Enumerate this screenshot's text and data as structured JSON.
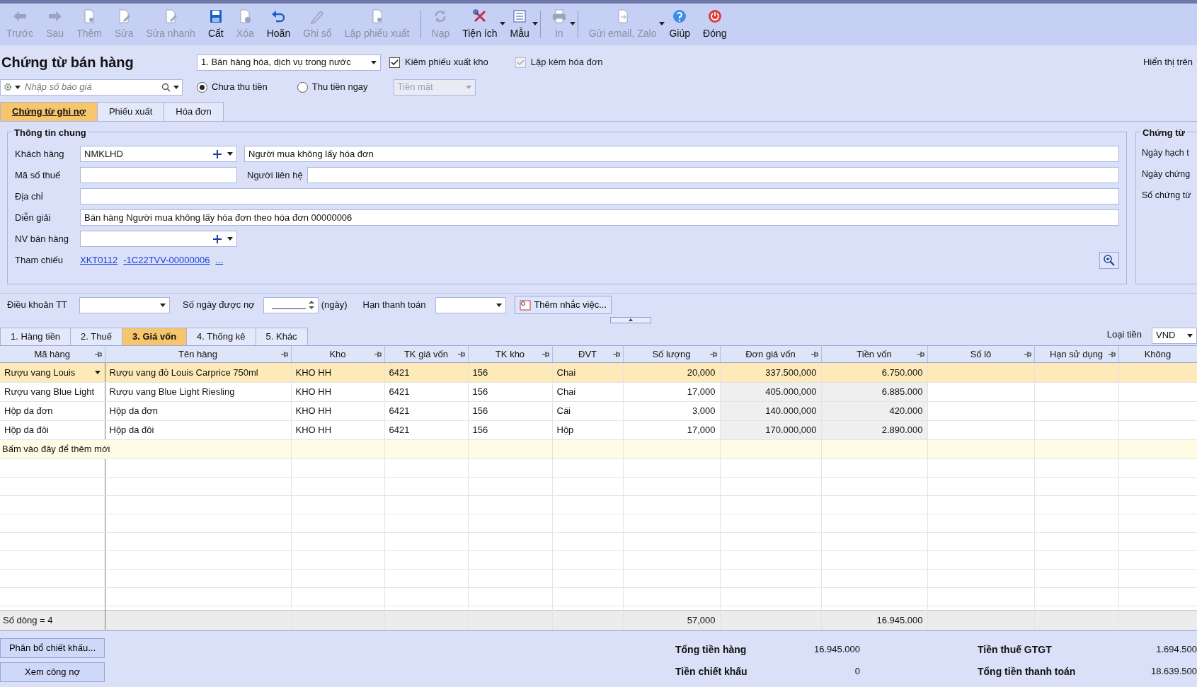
{
  "toolbar_groups": [
    [
      {
        "label": "Trước",
        "enabled": false,
        "dropdown": false
      },
      {
        "label": "Sau",
        "enabled": false,
        "dropdown": false
      },
      {
        "label": "Thêm",
        "enabled": false,
        "dropdown": false
      },
      {
        "label": "Sửa",
        "enabled": false,
        "dropdown": false
      },
      {
        "label": "Sửa nhanh",
        "enabled": false,
        "dropdown": false
      },
      {
        "label": "Cất",
        "enabled": true,
        "dropdown": false
      },
      {
        "label": "Xóa",
        "enabled": false,
        "dropdown": false
      },
      {
        "label": "Hoãn",
        "enabled": true,
        "dropdown": false
      },
      {
        "label": "Ghi sổ",
        "enabled": false,
        "dropdown": false
      },
      {
        "label": "Lập phiếu xuất",
        "enabled": false,
        "dropdown": false
      }
    ],
    [
      {
        "label": "Nạp",
        "enabled": false,
        "dropdown": false
      },
      {
        "label": "Tiện ích",
        "enabled": true,
        "dropdown": true
      },
      {
        "label": "Mẫu",
        "enabled": true,
        "dropdown": true
      }
    ],
    [
      {
        "label": "In",
        "enabled": false,
        "dropdown": true
      }
    ],
    [
      {
        "label": "Gửi email, Zalo",
        "enabled": false,
        "dropdown": true
      },
      {
        "label": "Giúp",
        "enabled": true,
        "dropdown": false
      },
      {
        "label": "Đóng",
        "enabled": true,
        "dropdown": false
      }
    ]
  ],
  "title": "Chứng từ bán hàng",
  "voucher_type": {
    "value": "1. Bán hàng hóa, dịch vụ trong nước"
  },
  "options": [
    {
      "label": "Kiêm phiếu xuất kho",
      "checked": true,
      "disabled": false
    },
    {
      "label": "Lập kèm hóa đơn",
      "checked": true,
      "disabled": true
    }
  ],
  "display_on": "Hiển thị trên",
  "quote_search": {
    "placeholder": "Nhập số báo giá"
  },
  "payment": [
    {
      "label": "Chưa thu tiền",
      "selected": true
    },
    {
      "label": "Thu tiền ngay",
      "selected": false
    }
  ],
  "payment_method": {
    "value": "Tiền mặt",
    "disabled": true
  },
  "doc_tabs": [
    {
      "label": "Chứng từ ghi nợ",
      "selected": true
    },
    {
      "label": "Phiếu xuất",
      "selected": false
    },
    {
      "label": "Hóa đơn",
      "selected": false
    }
  ],
  "general_info": {
    "title": "Thông tin chung",
    "customer": {
      "label": "Khách hàng",
      "code": "NMKLHD",
      "name": "Người mua không lấy hóa đơn"
    },
    "tax_code": {
      "label": "Mã số thuế"
    },
    "contact": {
      "label": "Người liên hệ"
    },
    "address": {
      "label": "Địa chỉ"
    },
    "description": {
      "label": "Diễn giải",
      "value": "Bán hàng Người mua không lấy hóa đơn theo hóa đơn 00000006"
    },
    "salesperson": {
      "label": "NV bán hàng"
    },
    "reference": {
      "label": "Tham chiếu",
      "links": [
        "XKT0112",
        "-1C22TVV-00000006",
        "..."
      ]
    }
  },
  "voucher_panel": {
    "title": "Chứng từ",
    "labels": [
      "Ngày hạch t",
      "Ngày chứng",
      "Số chứng từ"
    ]
  },
  "terms": {
    "payment_terms_label": "Điều khoản TT",
    "credit_days_label": "Số ngày được nợ",
    "days_unit": "(ngày)",
    "due_date_label": "Hạn thanh toán",
    "reminder_button": "Thêm nhắc việc..."
  },
  "grid_tabs": [
    {
      "label": "1. Hàng tiền",
      "selected": false
    },
    {
      "label": "2. Thuế",
      "selected": false
    },
    {
      "label": "3. Giá vốn",
      "selected": true
    },
    {
      "label": "4. Thống kê",
      "selected": false
    },
    {
      "label": "5. Khác",
      "selected": false
    }
  ],
  "currency": {
    "label": "Loại tiền",
    "value": "VND"
  },
  "table": {
    "columns": [
      {
        "label": "Mã hàng",
        "kind": "text",
        "shaded": false
      },
      {
        "label": "Tên hàng",
        "kind": "text",
        "shaded": false
      },
      {
        "label": "Kho",
        "kind": "text",
        "shaded": false
      },
      {
        "label": "TK giá vốn",
        "kind": "text",
        "shaded": false
      },
      {
        "label": "TK kho",
        "kind": "text",
        "shaded": false
      },
      {
        "label": "ĐVT",
        "kind": "text",
        "shaded": false
      },
      {
        "label": "Số lượng",
        "kind": "number",
        "shaded": false
      },
      {
        "label": "Đơn giá vốn",
        "kind": "number",
        "shaded": true
      },
      {
        "label": "Tiền vốn",
        "kind": "number",
        "shaded": true
      },
      {
        "label": "Số lô",
        "kind": "text",
        "shaded": false
      },
      {
        "label": "Hạn sử dụng",
        "kind": "text",
        "shaded": false
      },
      {
        "label": "Không",
        "kind": "text",
        "shaded": false
      }
    ],
    "rows": [
      {
        "selected": true,
        "cells": [
          "Rượu vang Louis",
          "Rượu vang đỏ Louis Carprice 750ml",
          "KHO HH",
          "6421",
          "156",
          "Chai",
          "20,000",
          "337.500,000",
          "6.750.000"
        ]
      },
      {
        "selected": false,
        "cells": [
          "Rượu vang Blue Light",
          "Rượu vang Blue Light Riesling",
          "KHO HH",
          "6421",
          "156",
          "Chai",
          "17,000",
          "405.000,000",
          "6.885.000"
        ]
      },
      {
        "selected": false,
        "cells": [
          "Hộp da đơn",
          "Hộp da đơn",
          "KHO HH",
          "6421",
          "156",
          "Cái",
          "3,000",
          "140.000,000",
          "420.000"
        ]
      },
      {
        "selected": false,
        "cells": [
          "Hộp da đôi",
          "Hộp da đôi",
          "KHO HH",
          "6421",
          "156",
          "Hộp",
          "17,000",
          "170.000,000",
          "2.890.000"
        ]
      }
    ],
    "add_row": "Bấm vào đây để thêm mới",
    "footer": {
      "row_count": "Số dòng = 4",
      "quantity_total": "57,000",
      "cost_total": "16.945.000"
    }
  },
  "bottom_buttons": [
    "Phân bổ chiết khấu...",
    "Xem công nợ"
  ],
  "totals": [
    {
      "label": "Tổng tiền hàng",
      "value": "16.945.000"
    },
    {
      "label": "Tiền chiết khấu",
      "value": "0"
    },
    {
      "label": "Tiền thuế GTGT",
      "value": "1.694.500"
    },
    {
      "label": "Tổng tiền thanh toán",
      "value": "18.639.500"
    }
  ]
}
